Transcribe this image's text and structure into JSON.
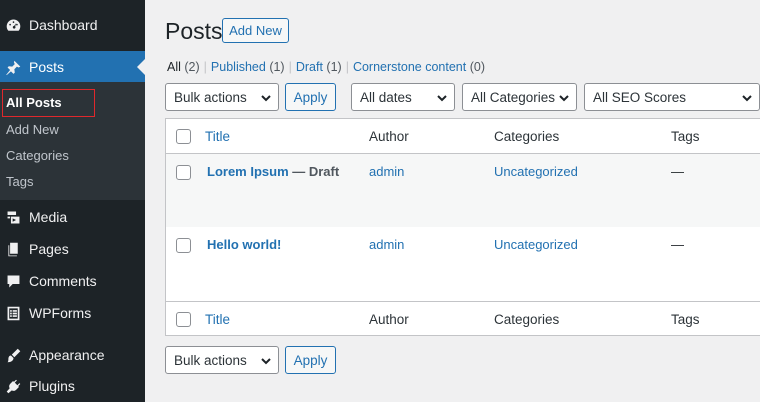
{
  "sidebar": {
    "items": [
      {
        "label": "Dashboard",
        "icon": "dashboard-icon"
      },
      {
        "label": "Posts",
        "icon": "pin-icon"
      },
      {
        "label": "Media",
        "icon": "media-icon"
      },
      {
        "label": "Pages",
        "icon": "pages-icon"
      },
      {
        "label": "Comments",
        "icon": "comment-icon"
      },
      {
        "label": "WPForms",
        "icon": "forms-icon"
      },
      {
        "label": "Appearance",
        "icon": "brush-icon"
      },
      {
        "label": "Plugins",
        "icon": "plug-icon"
      }
    ],
    "submenu": [
      "All Posts",
      "Add New",
      "Categories",
      "Tags"
    ]
  },
  "header": {
    "title": "Posts",
    "add_new": "Add New"
  },
  "views": {
    "all": {
      "label": "All",
      "count": "(2)"
    },
    "published": {
      "label": "Published",
      "count": "(1)"
    },
    "draft": {
      "label": "Draft",
      "count": "(1)"
    },
    "cornerstone": {
      "label": "Cornerstone content",
      "count": "(0)"
    },
    "separator": "|"
  },
  "filters": {
    "bulk_actions": "Bulk actions",
    "apply": "Apply",
    "dates": "All dates",
    "categories": "All Categories",
    "seo": "All SEO Scores"
  },
  "table": {
    "columns": [
      "Title",
      "Author",
      "Categories",
      "Tags"
    ],
    "rows": [
      {
        "title": "Lorem Ipsum",
        "state": "— Draft",
        "author": "admin",
        "category": "Uncategorized",
        "tags": "—"
      },
      {
        "title": "Hello world!",
        "state": "",
        "author": "admin",
        "category": "Uncategorized",
        "tags": "—"
      }
    ]
  },
  "colors": {
    "sidebar_bg": "#1d2327",
    "accent": "#2271b1",
    "highlight": "#e0282c"
  }
}
